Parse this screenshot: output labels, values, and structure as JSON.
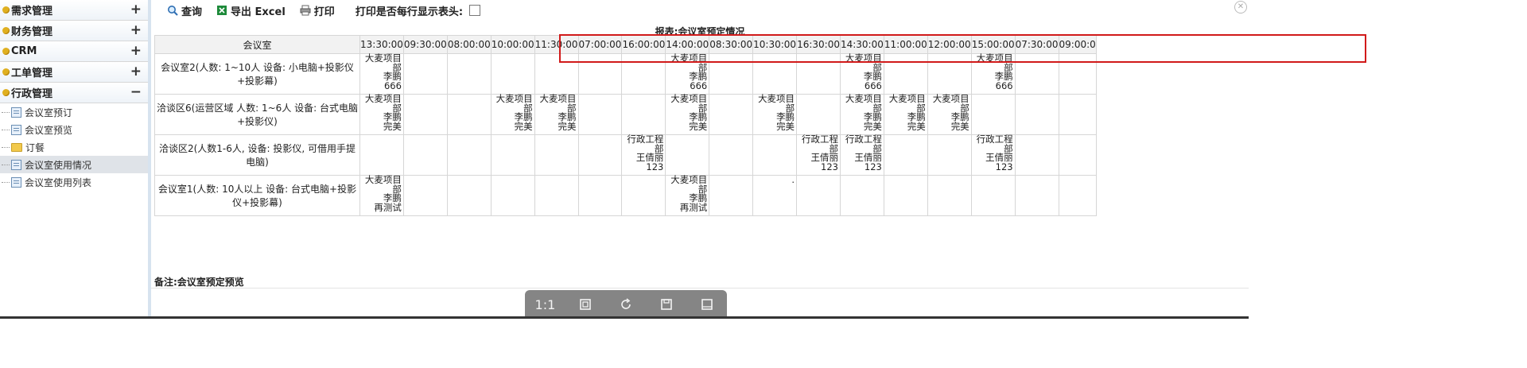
{
  "sidebar": {
    "menus": [
      {
        "label": "需求管理",
        "toggle": "+"
      },
      {
        "label": "财务管理",
        "toggle": "+"
      },
      {
        "label": "CRM",
        "toggle": "+"
      },
      {
        "label": "工单管理",
        "toggle": "+"
      },
      {
        "label": "行政管理",
        "toggle": "−"
      }
    ],
    "subitems": [
      {
        "label": "会议室预订",
        "icon": "doc-icon"
      },
      {
        "label": "会议室预览",
        "icon": "doc-icon"
      },
      {
        "label": "订餐",
        "icon": "folder-icon"
      },
      {
        "label": "会议室使用情况",
        "icon": "doc-icon"
      },
      {
        "label": "会议室使用列表",
        "icon": "doc-icon"
      }
    ]
  },
  "toolbar": {
    "query": "查询",
    "export": "导出 Excel",
    "print": "打印",
    "print_header_label": "打印是否每行显示表头:"
  },
  "report": {
    "title": "报表:会议室预定情况",
    "room_header": "会议室",
    "times": [
      "13:30:00",
      "09:30:00",
      "08:00:00",
      "10:00:00",
      "11:30:00",
      "07:00:00",
      "16:00:00",
      "14:00:00",
      "08:30:00",
      "10:30:00",
      "16:30:00",
      "14:30:00",
      "11:00:00",
      "12:00:00",
      "15:00:00",
      "07:30:00",
      "09:00:0"
    ],
    "rows": [
      {
        "room": "会议室2(人数: 1~10人 设备: 小电脑+投影仪+投影幕)",
        "cells": [
          [
            "大麦项目",
            "部",
            "李鹏",
            "666"
          ],
          [],
          [],
          [],
          [],
          [],
          [],
          [
            "大麦项目",
            "部",
            "李鹏",
            "666"
          ],
          [],
          [],
          [],
          [
            "大麦项目",
            "部",
            "李鹏",
            "666"
          ],
          [],
          [],
          [
            "大麦项目",
            "部",
            "李鹏",
            "666"
          ],
          [],
          []
        ]
      },
      {
        "room": "洽谈区6(运营区域 人数: 1~6人 设备: 台式电脑+投影仪)",
        "cells": [
          [
            "大麦项目",
            "部",
            "李鹏",
            "完美"
          ],
          [],
          [],
          [
            "大麦项目",
            "部",
            "李鹏",
            "完美"
          ],
          [
            "大麦项目",
            "部",
            "李鹏",
            "完美"
          ],
          [],
          [],
          [
            "大麦项目",
            "部",
            "李鹏",
            "完美"
          ],
          [],
          [
            "大麦项目",
            "部",
            "李鹏",
            "完美"
          ],
          [],
          [
            "大麦项目",
            "部",
            "李鹏",
            "完美"
          ],
          [
            "大麦项目",
            "部",
            "李鹏",
            "完美"
          ],
          [
            "大麦项目",
            "部",
            "李鹏",
            "完美"
          ],
          [],
          [],
          []
        ]
      },
      {
        "room": "洽谈区2(人数1-6人, 设备: 投影仪, 可借用手提电脑)",
        "cells": [
          [],
          [],
          [],
          [],
          [],
          [],
          [
            "行政工程",
            "部",
            "王倩丽",
            "123"
          ],
          [],
          [],
          [],
          [
            "行政工程",
            "部",
            "王倩丽",
            "123"
          ],
          [
            "行政工程",
            "部",
            "王倩丽",
            "123"
          ],
          [],
          [],
          [
            "行政工程",
            "部",
            "王倩丽",
            "123"
          ],
          [],
          []
        ]
      },
      {
        "room": "会议室1(人数: 10人以上 设备: 台式电脑+投影仪+投影幕)",
        "cells": [
          [
            "大麦项目",
            "部",
            "李鹏",
            "再测试"
          ],
          [],
          [],
          [],
          [],
          [],
          [],
          [
            "大麦项目",
            "部",
            "李鹏",
            "再测试"
          ],
          [],
          [
            "."
          ],
          [],
          [],
          [],
          [],
          [],
          [],
          []
        ]
      }
    ],
    "note": "备注:会议室预定预览"
  },
  "image_viewer": {
    "ratio": "1:1"
  }
}
